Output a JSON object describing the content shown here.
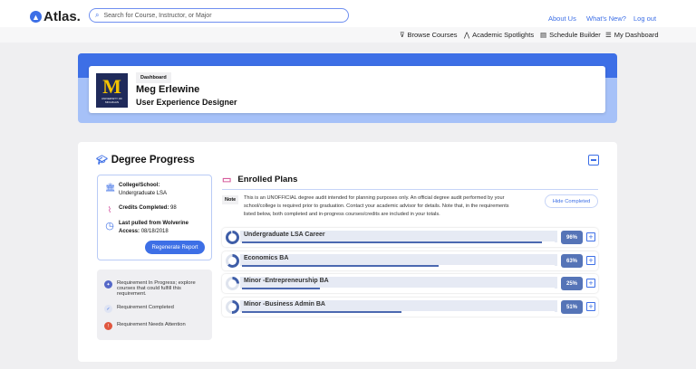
{
  "header": {
    "logo": "Atlas.",
    "search_placeholder": "Search for Course, Instructor, or Major",
    "links": [
      "About Us",
      "What's New?",
      "Log out"
    ]
  },
  "nav": {
    "items": [
      {
        "label": "Browse Courses",
        "icon": "filter-icon"
      },
      {
        "label": "Academic Spotlights",
        "icon": "tent-icon"
      },
      {
        "label": "Schedule Builder",
        "icon": "calendar-icon"
      },
      {
        "label": "My Dashboard",
        "icon": "dashboard-icon"
      }
    ]
  },
  "profile": {
    "tag": "Dashboard",
    "name": "Meg Erlewine",
    "role": "User Experience Designer",
    "logo_text": "M",
    "logo_sub": "UNIVERSITY OF MICHIGAN"
  },
  "degree": {
    "title": "Degree Progress",
    "college_label": "College/School:",
    "college_value": "Undergraduate LSA",
    "credits_label": "Credits Completed:",
    "credits_value": "98",
    "pulled_label": "Last pulled from Wolverine Access:",
    "pulled_value": "08/18/2018",
    "regen": "Regenerate Report",
    "legend": [
      "Requirement In Progress; explore courses that could fulfill this requirement.",
      "Requirement Completed",
      "Requirement Needs Attention"
    ]
  },
  "plans": {
    "title": "Enrolled Plans",
    "note_tag": "Note",
    "note": "This is an UNOFFICIAL degree audit intended for planning purposes only. An official degree audit performed by your school/college is required prior to graduation. Contact your academic advisor for details. Note that, in the requirements listed below, both completed and in-progress courses/credits are included in your totals.",
    "hide": "Hide Completed",
    "items": [
      {
        "name": "Undergraduate LSA Career",
        "pct": "96%",
        "value": 96
      },
      {
        "name": "Economics BA",
        "pct": "63%",
        "value": 63
      },
      {
        "name": "Minor -Entrepreneurship BA",
        "pct": "25%",
        "value": 25
      },
      {
        "name": "Minor -Business Admin BA",
        "pct": "51%",
        "value": 51
      }
    ]
  },
  "colors": {
    "accent": "#3d6fe6",
    "progress": "#4b68b0",
    "michigan_blue": "#1f2a5a",
    "michigan_maize": "#f2c200"
  }
}
